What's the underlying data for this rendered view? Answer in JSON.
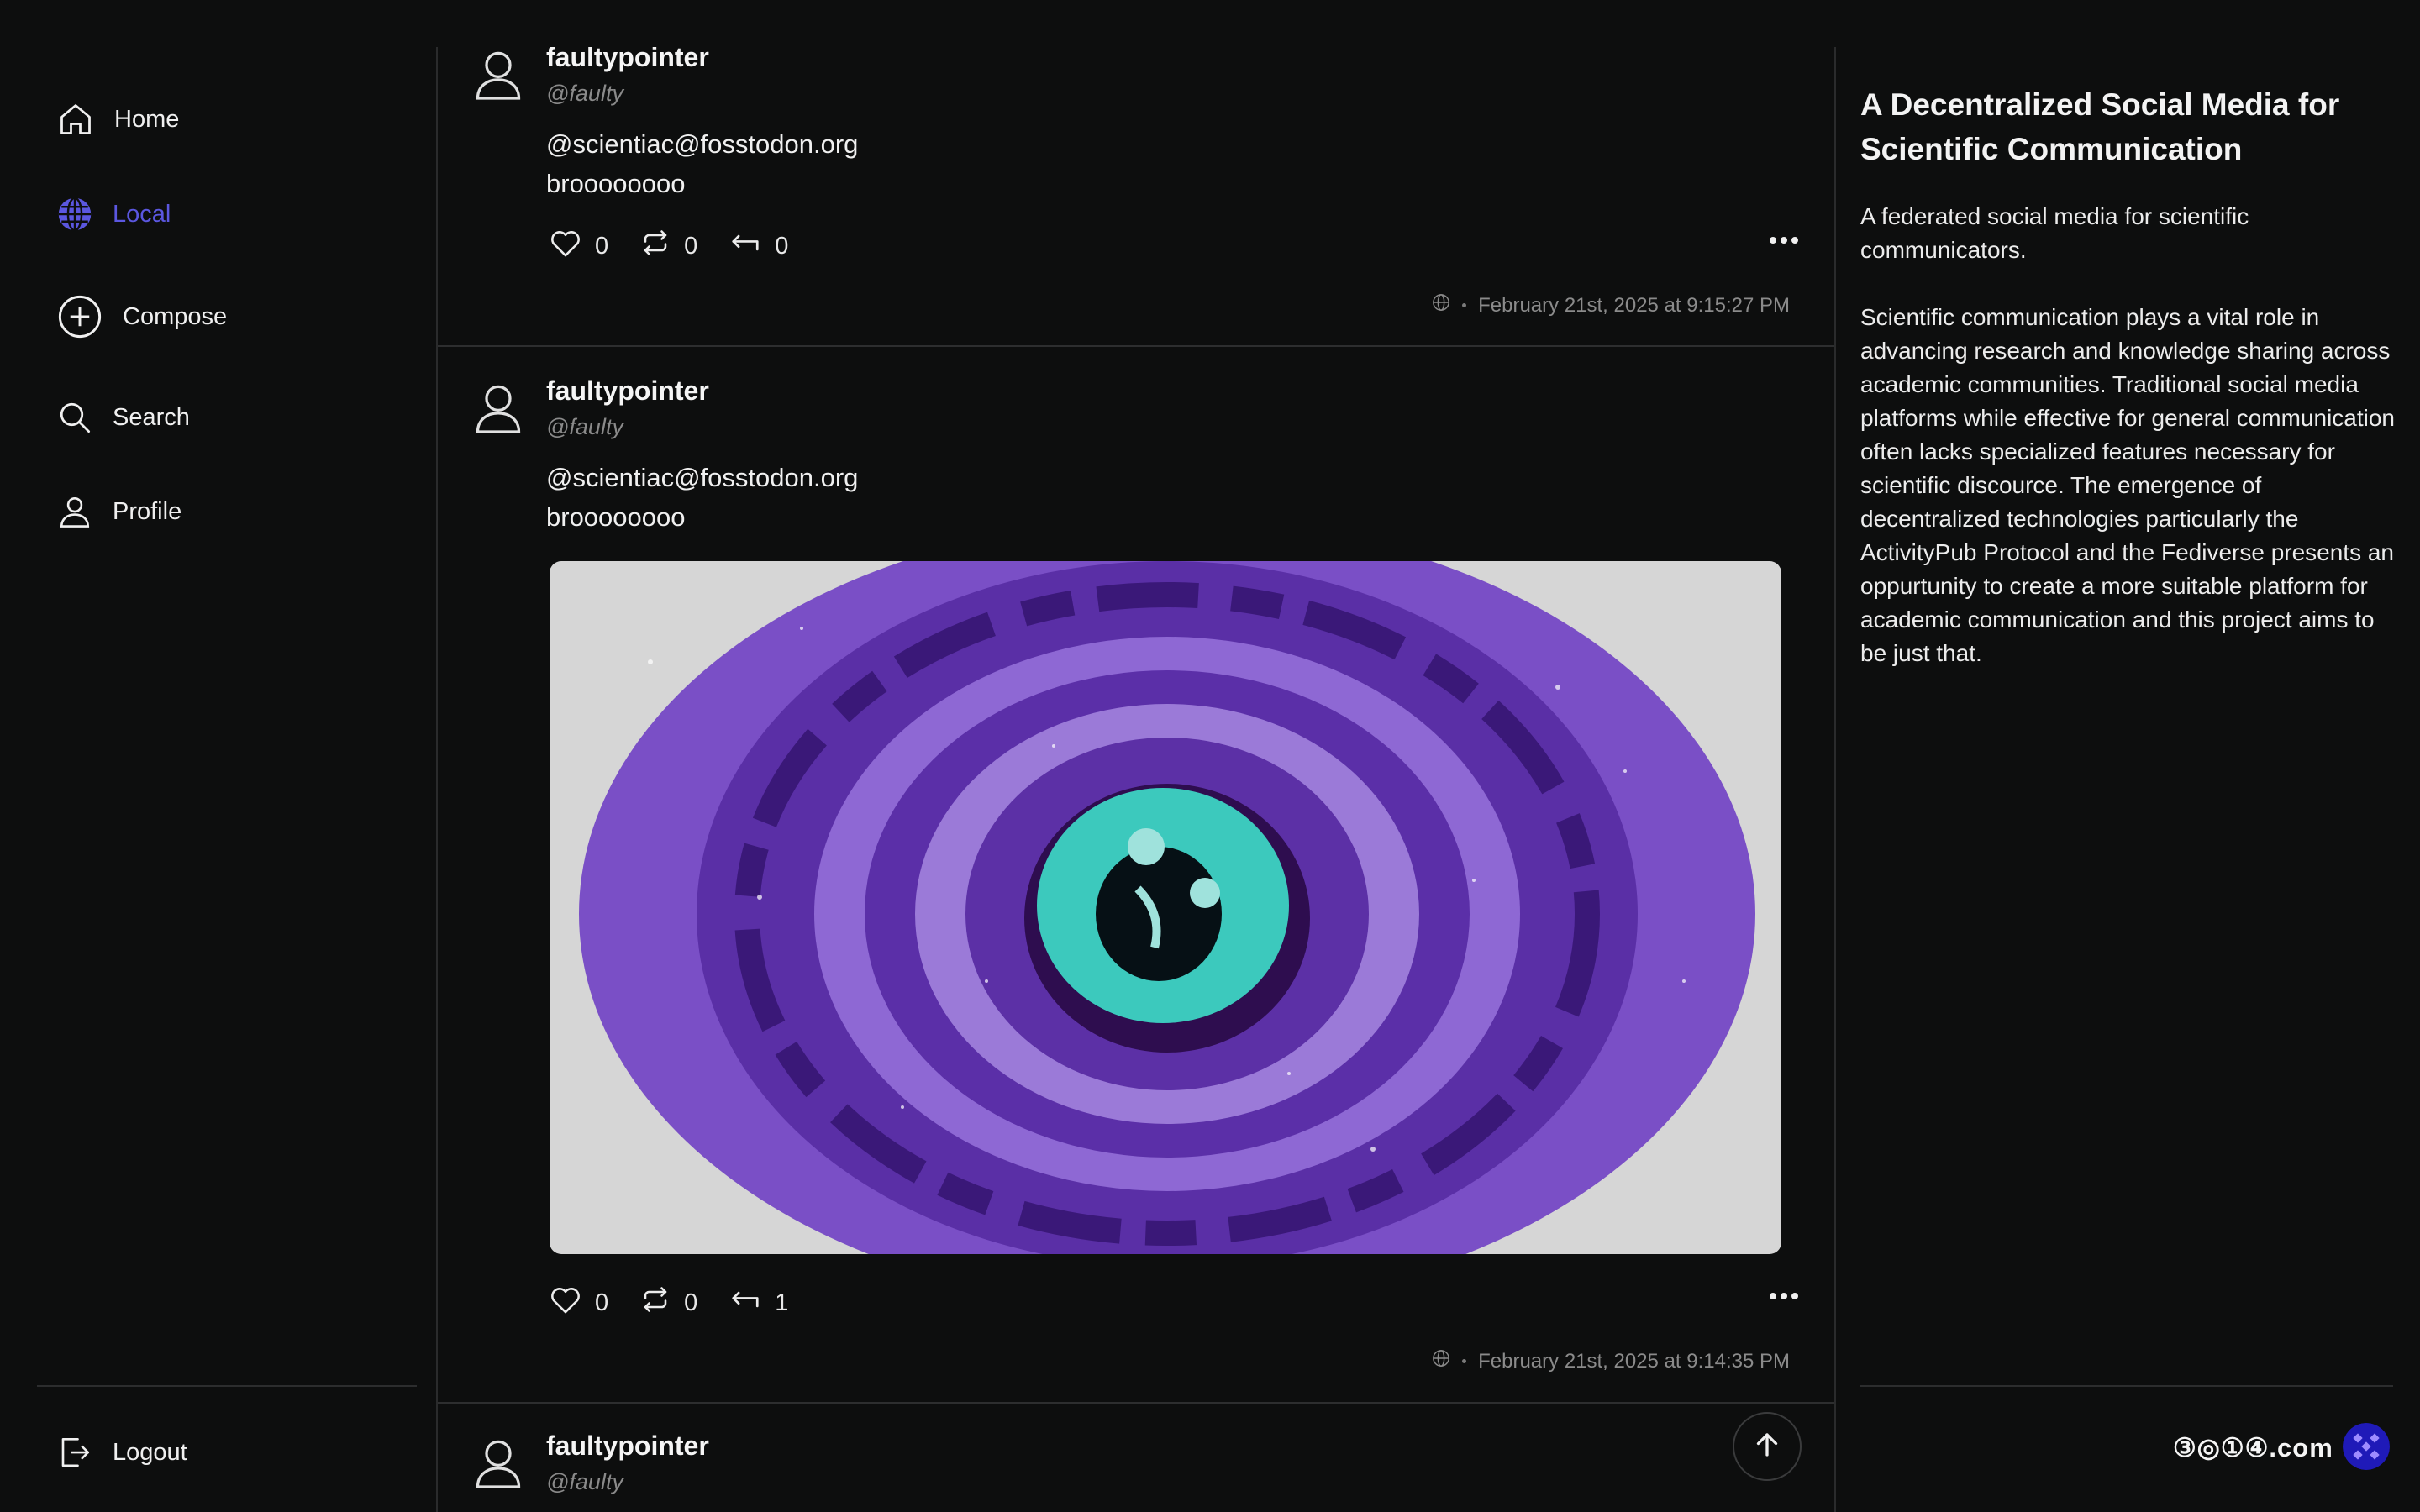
{
  "nav": {
    "home": "Home",
    "local": "Local",
    "compose": "Compose",
    "search": "Search",
    "profile": "Profile",
    "logout": "Logout"
  },
  "posts": [
    {
      "author": "faultypointer",
      "handle": "@faulty",
      "lines": [
        "@scientiac@fosstodon.org",
        "broooooooo"
      ],
      "likes": "0",
      "boosts": "0",
      "replies": "0",
      "timestamp": "February 21st, 2025 at 9:15:27 PM"
    },
    {
      "author": "faultypointer",
      "handle": "@faulty",
      "lines": [
        "@scientiac@fosstodon.org",
        "broooooooo"
      ],
      "likes": "0",
      "boosts": "0",
      "replies": "1",
      "timestamp": "February 21st, 2025 at 9:14:35 PM"
    },
    {
      "author": "faultypointer",
      "handle": "@faulty"
    }
  ],
  "about": {
    "title": "A Decentralized Social Media for Scientific Communication",
    "subtitle": "A federated social media for scientific communicators.",
    "body": "Scientific communication plays a vital role in advancing research and knowledge sharing across academic communities. Traditional social media platforms while effective for general communication often lacks specialized features necessary for scientific discource. The emergence of decentralized technologies particularly the ActivityPub Protocol and the Fediverse presents an oppurtunity to create a more suitable platform for academic communication and this project aims to be just that."
  },
  "brand": "③◎①④.com",
  "colors": {
    "accent": "#5b57e0",
    "background": "#0d0e0e",
    "text": "#e8e8e8",
    "muted": "#8a8a8a"
  }
}
